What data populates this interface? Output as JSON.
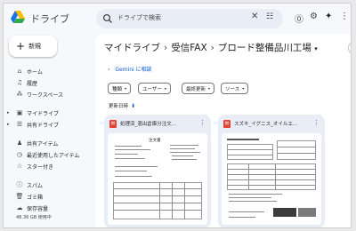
{
  "app": {
    "title": "ドライブ"
  },
  "search": {
    "placeholder": "ドライブで検索"
  },
  "sidebar": {
    "new_label": "新規",
    "items": [
      {
        "label": "ホーム",
        "icon": "home-icon"
      },
      {
        "label": "履歴",
        "icon": "history-icon"
      },
      {
        "label": "ワークスペース",
        "icon": "workspace-icon"
      },
      {
        "label": "マイドライブ",
        "icon": "drive-icon"
      },
      {
        "label": "共有ドライブ",
        "icon": "shared-drive-icon"
      },
      {
        "label": "共有アイテム",
        "icon": "shared-people-icon"
      },
      {
        "label": "最近使用したアイテム",
        "icon": "clock-icon"
      },
      {
        "label": "スター付き",
        "icon": "star-icon"
      },
      {
        "label": "スパム",
        "icon": "spam-icon"
      },
      {
        "label": "ゴミ箱",
        "icon": "trash-icon"
      },
      {
        "label": "保存容量",
        "icon": "cloud-icon"
      }
    ],
    "storage_text": "48.36 GB 使用中"
  },
  "breadcrumb": {
    "root": "マイドライブ",
    "mid": "受信FAX",
    "current": "ブロード整備品川工場"
  },
  "gemini": {
    "label": "Gemini に相談"
  },
  "filters": [
    "種類",
    "ユーザー",
    "最終更新",
    "ソース"
  ],
  "sort": {
    "label": "更新日時"
  },
  "files": [
    {
      "title": "処理済_混出倉庫分注文..."
    },
    {
      "title": "スズキ_イグニス_オイルエ..."
    }
  ],
  "doc1": {
    "heading": "注文書"
  },
  "colors": {
    "accent": "#0b57d0",
    "pdf": "#ea4335",
    "sidebar_bg": "#f6f8fc",
    "card_bg": "#e9eef6"
  }
}
